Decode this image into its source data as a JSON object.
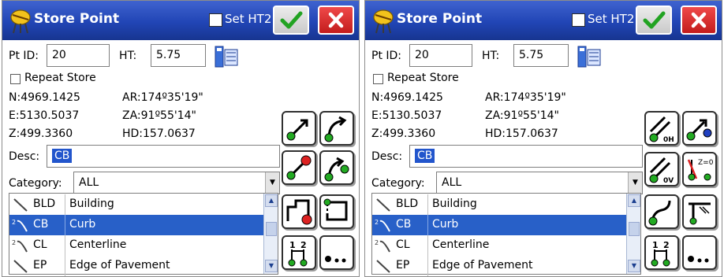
{
  "panels": [
    {
      "title": "Store Point",
      "set_ht2_label": "Set HT2",
      "pt_id_label": "Pt ID:",
      "pt_id_value": "20",
      "ht_label": "HT:",
      "ht_value": "5.75",
      "repeat_store_label": "Repeat Store",
      "north": "N:4969.1425",
      "east": "E:5130.5037",
      "elevation": "Z:499.3360",
      "azimuth": "AR:174º35'19\"",
      "zenith": "ZA:91º55'14\"",
      "horizontal_distance": "HD:157.0637",
      "desc_label": "Desc:",
      "desc_value": "CB",
      "category_label": "Category:",
      "category_value": "ALL",
      "features": [
        {
          "code": "BLD",
          "description": "Building"
        },
        {
          "code": "CB",
          "description": "Curb"
        },
        {
          "code": "CL",
          "description": "Centerline"
        },
        {
          "code": "EP",
          "description": "Edge of Pavement"
        }
      ],
      "selected_feature": "CB",
      "tool_buttons": [
        "line-start-icon",
        "arc-start-icon",
        "line-end-icon",
        "arc-end-icon",
        "close-polygon-icon",
        "close-rectangle-icon",
        "point-sequence-icon",
        "more-icon"
      ]
    },
    {
      "title": "Store Point",
      "set_ht2_label": "Set HT2",
      "pt_id_label": "Pt ID:",
      "pt_id_value": "20",
      "ht_label": "HT:",
      "ht_value": "5.75",
      "repeat_store_label": "Repeat Store",
      "north": "N:4969.1425",
      "east": "E:5130.5037",
      "elevation": "Z:499.3360",
      "azimuth": "AR:174º35'19\"",
      "zenith": "ZA:91º55'14\"",
      "horizontal_distance": "HD:157.0637",
      "desc_label": "Desc:",
      "desc_value": "CB",
      "category_label": "Category:",
      "category_value": "ALL",
      "features": [
        {
          "code": "BLD",
          "description": "Building"
        },
        {
          "code": "CB",
          "description": "Curb"
        },
        {
          "code": "CL",
          "description": "Centerline"
        },
        {
          "code": "EP",
          "description": "Edge of Pavement"
        }
      ],
      "selected_feature": "CB",
      "tool_buttons": [
        "offset-horizontal-icon",
        "smooth-point-icon",
        "offset-vertical-icon",
        "zero-elevation-icon",
        "curve-icon",
        "pc-point-icon",
        "point-sequence-icon",
        "more-icon"
      ],
      "offset_h_text": "0H",
      "offset_v_text": "0V",
      "zero_elev_text": "Z=0"
    }
  ],
  "colors": {
    "title_bar": "#2145b5",
    "selection": "#2860c8",
    "ok_green": "#22a322",
    "close_red": "#d42626",
    "node_green": "#22aa22",
    "node_red": "#dd2222",
    "node_blue": "#2040c0"
  }
}
